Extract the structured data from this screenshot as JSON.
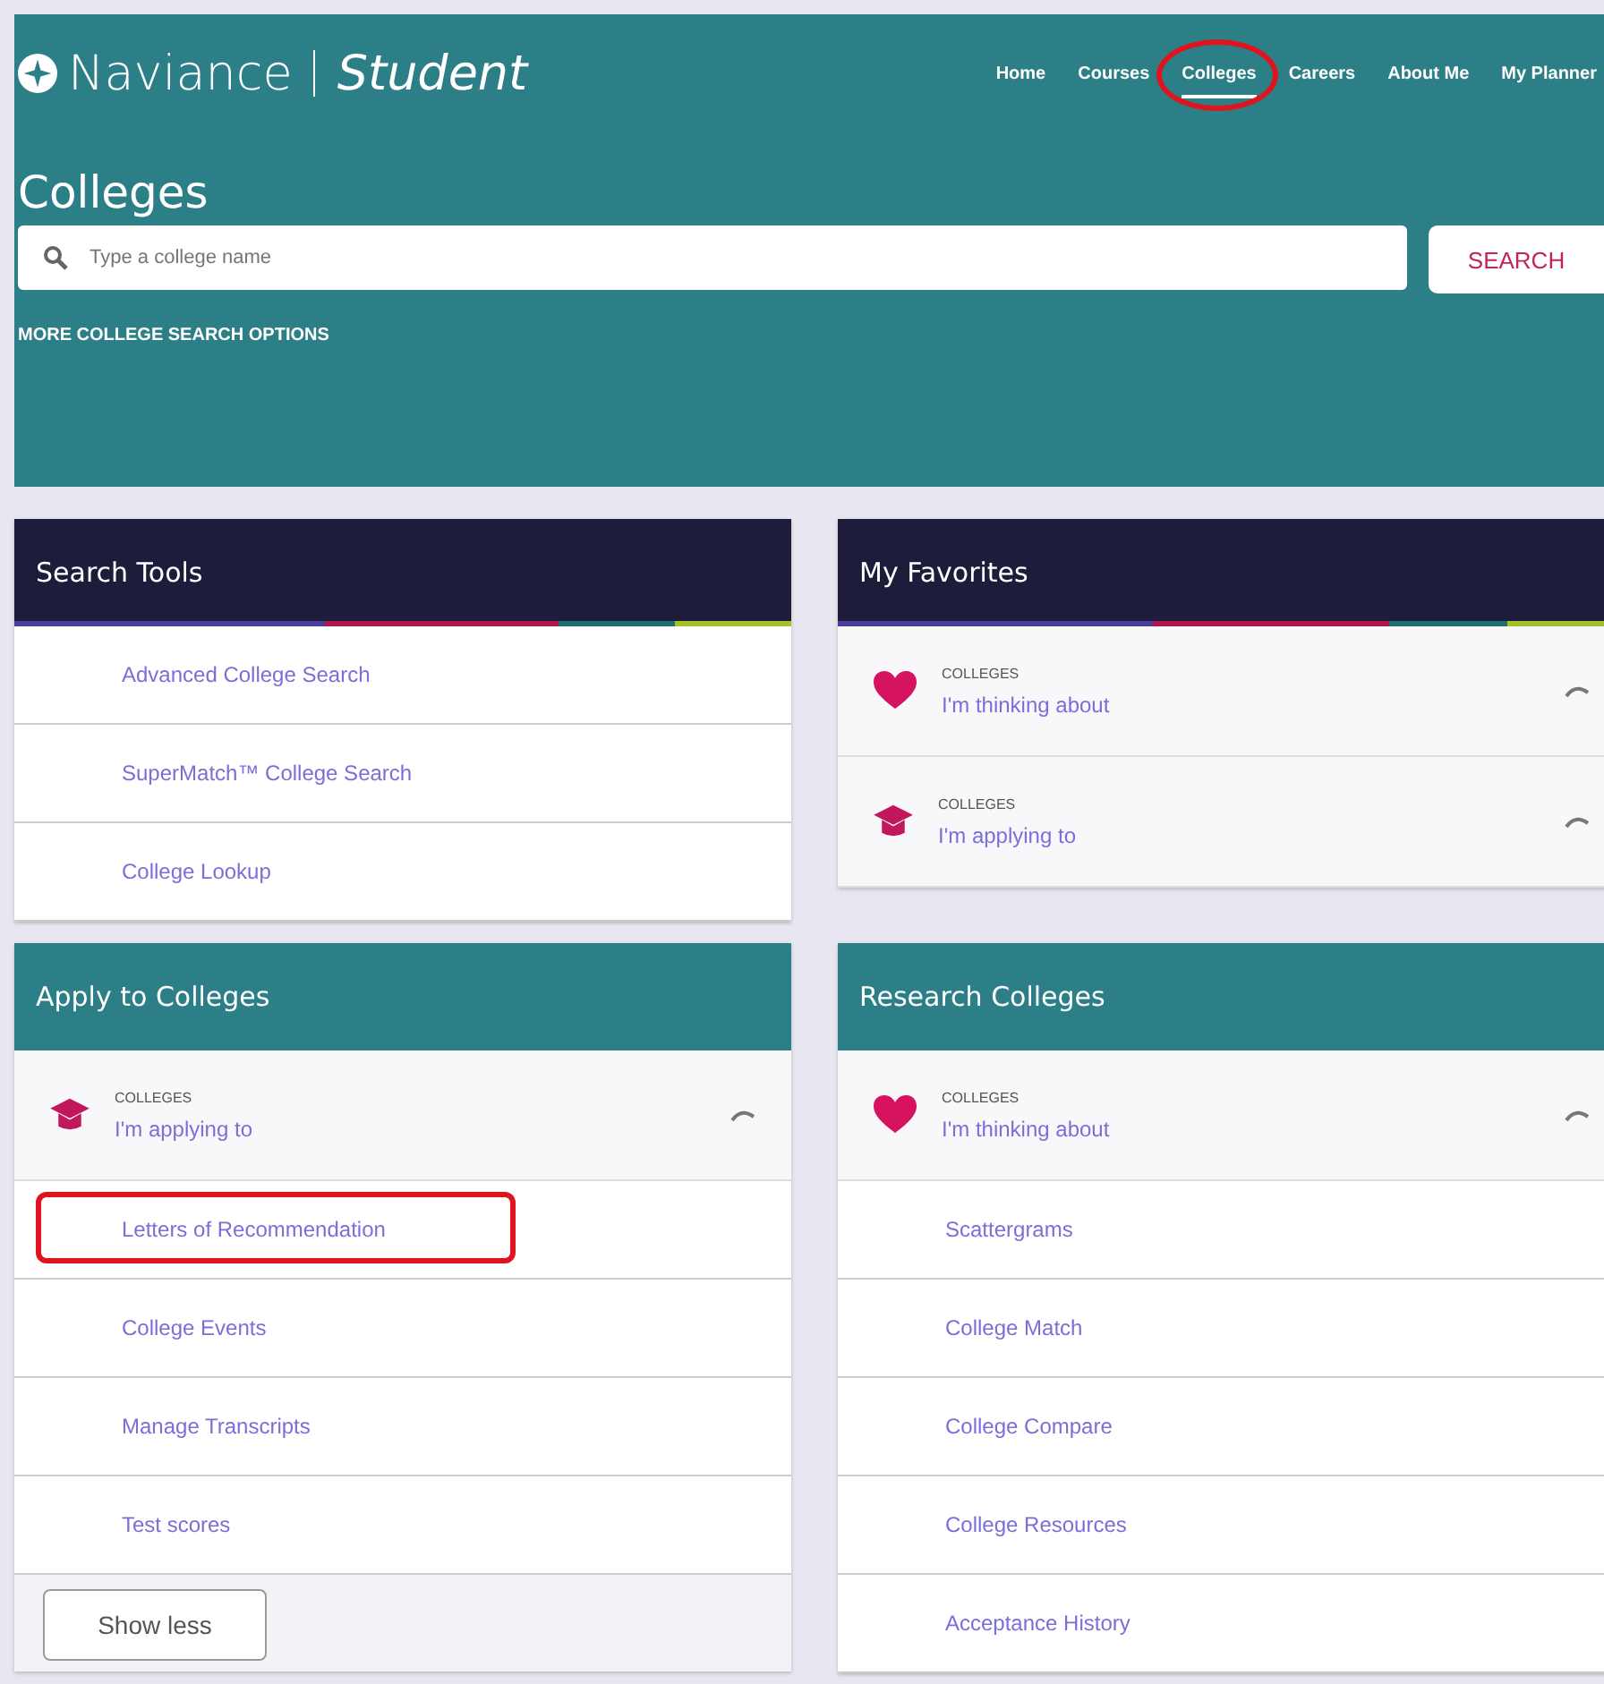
{
  "brand": {
    "name": "Naviance",
    "product": "Student"
  },
  "nav": [
    {
      "label": "Home",
      "selected": false,
      "circled": false
    },
    {
      "label": "Courses",
      "selected": false,
      "circled": false
    },
    {
      "label": "Colleges",
      "selected": true,
      "circled": true
    },
    {
      "label": "Careers",
      "selected": false,
      "circled": false
    },
    {
      "label": "About Me",
      "selected": false,
      "circled": false
    },
    {
      "label": "My Planner",
      "selected": false,
      "circled": false
    }
  ],
  "page_title": "Colleges",
  "search": {
    "placeholder": "Type a college name",
    "button": "SEARCH",
    "more_options": "MORE COLLEGE SEARCH OPTIONS"
  },
  "cards": [
    {
      "title": "Search Tools",
      "items": [
        {
          "kind": "link",
          "label": "Advanced College Search",
          "highlighted": false
        },
        {
          "kind": "link",
          "label": "SuperMatch™ College Search",
          "highlighted": false
        },
        {
          "kind": "link",
          "label": "College Lookup",
          "highlighted": false
        }
      ]
    },
    {
      "title": "My Favorites",
      "items": [
        {
          "kind": "heart",
          "category": "COLLEGES",
          "label": "I'm thinking about"
        },
        {
          "kind": "cap",
          "category": "COLLEGES",
          "label": "I'm applying to"
        }
      ]
    },
    {
      "title": "Apply to Colleges",
      "footer_button": "Show less",
      "items": [
        {
          "kind": "cap",
          "category": "COLLEGES",
          "label": "I'm applying to"
        },
        {
          "kind": "link",
          "label": "Letters of Recommendation",
          "highlighted": true
        },
        {
          "kind": "link",
          "label": "College Events",
          "highlighted": false
        },
        {
          "kind": "link",
          "label": "Manage Transcripts",
          "highlighted": false
        },
        {
          "kind": "link",
          "label": "Test scores",
          "highlighted": false
        }
      ]
    },
    {
      "title": "Research Colleges",
      "items": [
        {
          "kind": "heart",
          "category": "COLLEGES",
          "label": "I'm thinking about"
        },
        {
          "kind": "link",
          "label": "Scattergrams",
          "highlighted": false
        },
        {
          "kind": "link",
          "label": "College Match",
          "highlighted": false
        },
        {
          "kind": "link",
          "label": "College Compare",
          "highlighted": false
        },
        {
          "kind": "link",
          "label": "College Resources",
          "highlighted": false
        },
        {
          "kind": "link",
          "label": "Acceptance History",
          "highlighted": false
        }
      ]
    }
  ]
}
